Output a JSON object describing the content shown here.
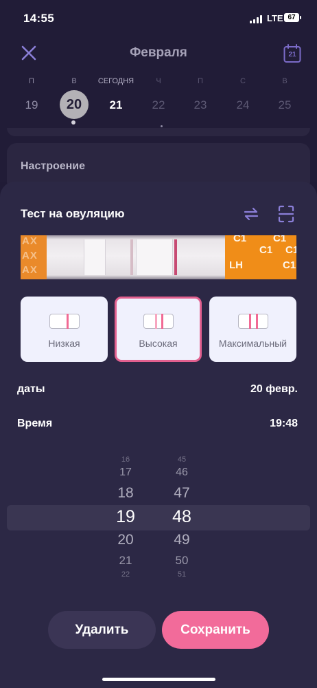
{
  "status_bar": {
    "time": "14:55",
    "network": "LTE",
    "battery": "67"
  },
  "header": {
    "title": "Февраля",
    "calendar_day": "21"
  },
  "week": [
    {
      "letter": "П",
      "number": "19",
      "state": "normal"
    },
    {
      "letter": "В",
      "number": "20",
      "state": "selected"
    },
    {
      "letter": "СЕГОДНЯ",
      "number": "21",
      "state": "today"
    },
    {
      "letter": "Ч",
      "number": "22",
      "state": "future"
    },
    {
      "letter": "П",
      "number": "23",
      "state": "future"
    },
    {
      "letter": "С",
      "number": "24",
      "state": "future"
    },
    {
      "letter": "В",
      "number": "25",
      "state": "future"
    }
  ],
  "mood_card": {
    "title": "Настроение"
  },
  "sheet": {
    "title": "Тест на овуляцию",
    "strip_marks": {
      "left": [
        "AX",
        "AX",
        "AX"
      ],
      "right": [
        "C1",
        "C1",
        "LH",
        "C1",
        "C1",
        "C1"
      ]
    },
    "options": [
      {
        "label": "Низкая",
        "selected": false
      },
      {
        "label": "Высокая",
        "selected": true
      },
      {
        "label": "Максимальный",
        "selected": false
      }
    ],
    "date_label": "даты",
    "date_value": "20 февр.",
    "time_label": "Время",
    "time_value": "19:48",
    "picker": {
      "hours": [
        "16",
        "17",
        "18",
        "19",
        "20",
        "21",
        "22"
      ],
      "minutes": [
        "45",
        "46",
        "47",
        "48",
        "49",
        "50",
        "51"
      ],
      "selected_hour": "19",
      "selected_minute": "48"
    },
    "delete_label": "Удалить",
    "save_label": "Сохранить"
  },
  "colors": {
    "accent": "#f26b9a",
    "icon_purple": "#8b7fd8",
    "background": "#201b36",
    "sheet": "#2c2845"
  }
}
